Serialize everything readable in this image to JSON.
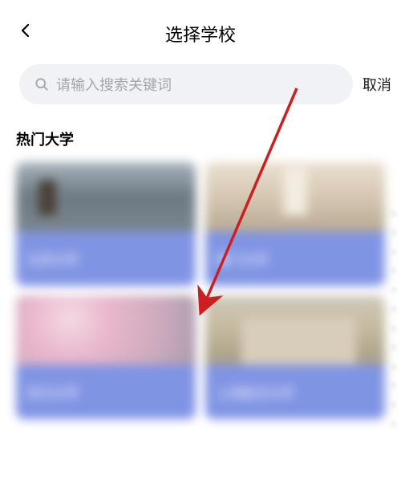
{
  "header": {
    "title": "选择学校"
  },
  "search": {
    "placeholder": "请输入搜索关键词",
    "cancel": "取消"
  },
  "section": {
    "title": "热门大学"
  },
  "cards": [
    {
      "label": "北京大学"
    },
    {
      "label": "厦门大学"
    },
    {
      "label": "武汉大学"
    },
    {
      "label": "上海复旦大学"
    }
  ],
  "annotation": {
    "arrow_color": "#cc1f1f"
  }
}
